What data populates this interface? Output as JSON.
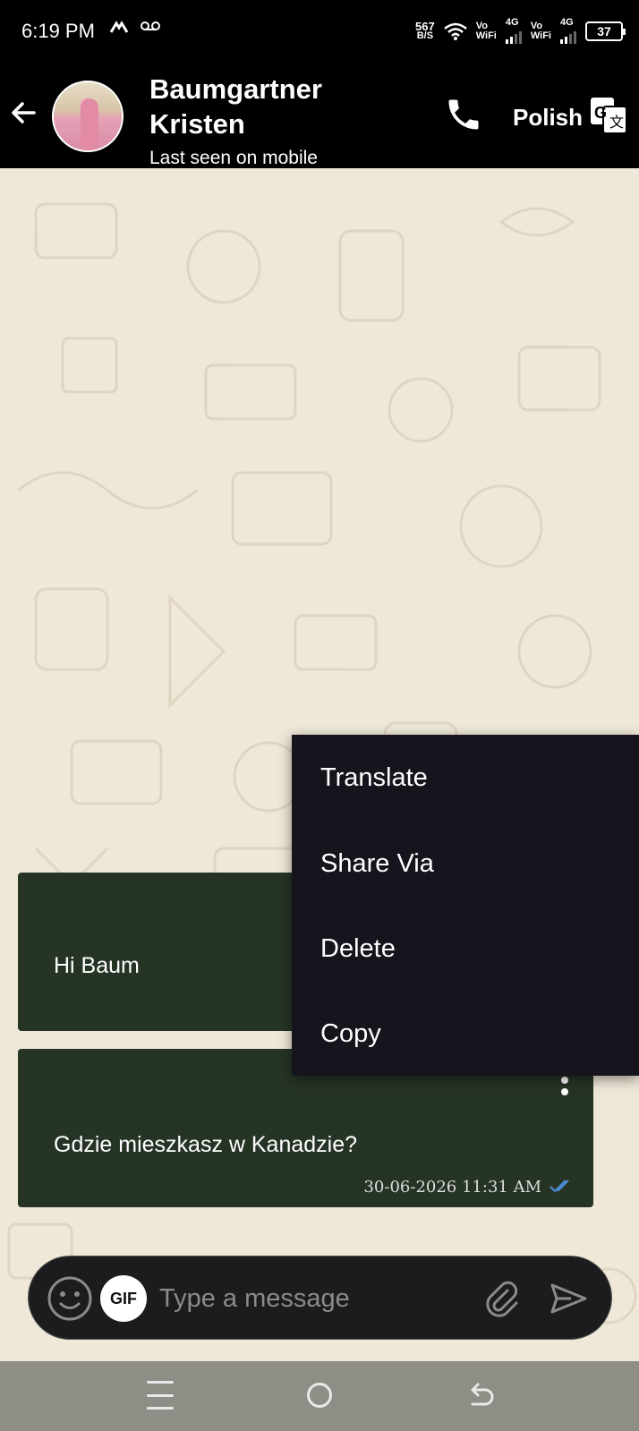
{
  "status_bar": {
    "time": "6:19 PM",
    "speed_value": "567",
    "speed_unit": "B/S",
    "sim1_label_top": "Vo",
    "sim1_label_bottom": "WiFi",
    "sim1_network": "4G",
    "sim2_label_top": "Vo",
    "sim2_label_bottom": "WiFi",
    "sim2_network": "4G",
    "battery": "37"
  },
  "header": {
    "contact_name": "Baumgartner Kristen",
    "last_seen": "Last seen on mobile",
    "language": "Polish"
  },
  "messages": [
    {
      "text": "Hi Baum"
    },
    {
      "text": "Gdzie mieszkasz w Kanadzie?",
      "timestamp": "30-06-2026 11:31 AM"
    }
  ],
  "context_menu": {
    "items": [
      "Translate",
      "Share Via",
      "Delete",
      "Copy"
    ]
  },
  "input": {
    "gif_label": "GIF",
    "placeholder": "Type a message"
  },
  "colors": {
    "bubble": "#263426",
    "menu": "#16141c",
    "header": "#000000",
    "chat_bg": "#efe8d8"
  }
}
